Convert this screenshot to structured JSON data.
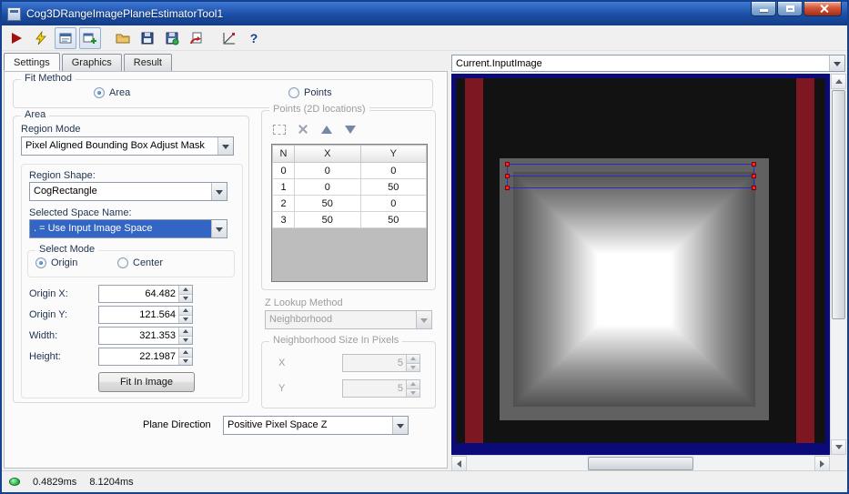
{
  "colors": {
    "titlebar_blue": "#1c4ea6",
    "selection_highlight": "#3365c4",
    "image_frame_navy": "#0a0a78",
    "image_stripe_red": "#7d1722",
    "selection_rect_blue": "#2a2ad0",
    "handle_red": "#ff2020",
    "led_green": "#2fbe4e"
  },
  "window": {
    "title": "Cog3DRangeImagePlaneEstimatorTool1"
  },
  "toolbar": {
    "icons": [
      "run-icon",
      "live-run-icon",
      "tool-editor-icon",
      "new-tool-icon",
      "open-file-icon",
      "save-icon",
      "save-image-icon",
      "revert-icon",
      "benchmark-icon",
      "help-icon"
    ],
    "help_glyph": "?"
  },
  "tabs": {
    "items": [
      {
        "label": "Settings",
        "active": true
      },
      {
        "label": "Graphics",
        "active": false
      },
      {
        "label": "Result",
        "active": false
      }
    ]
  },
  "settings": {
    "fit_method": {
      "label": "Fit Method",
      "options": [
        {
          "label": "Area",
          "selected": true
        },
        {
          "label": "Points",
          "selected": false
        }
      ]
    },
    "area": {
      "label": "Area",
      "region_mode_label": "Region Mode",
      "region_mode_value": "Pixel Aligned Bounding Box Adjust Mask",
      "region_shape_label": "Region Shape:",
      "region_shape_value": "CogRectangle",
      "selected_space_label": "Selected Space Name:",
      "selected_space_value": ". = Use Input Image Space",
      "select_mode": {
        "label": "Select Mode",
        "options": [
          {
            "label": "Origin",
            "selected": true
          },
          {
            "label": "Center",
            "selected": false
          }
        ]
      },
      "fields": [
        {
          "label": "Origin X:",
          "value": "64.482"
        },
        {
          "label": "Origin Y:",
          "value": "121.564"
        },
        {
          "label": "Width:",
          "value": "321.353"
        },
        {
          "label": "Height:",
          "value": "22.1987"
        }
      ],
      "fit_button_label": "Fit In Image"
    },
    "points": {
      "label": "Points (2D locations)",
      "table": {
        "headers": [
          "N",
          "X",
          "Y"
        ],
        "rows": [
          [
            "0",
            "0",
            "0"
          ],
          [
            "1",
            "0",
            "50"
          ],
          [
            "2",
            "50",
            "0"
          ],
          [
            "3",
            "50",
            "50"
          ]
        ]
      }
    },
    "z_lookup": {
      "label": "Z Lookup Method",
      "value": "Neighborhood"
    },
    "neighborhood": {
      "label": "Neighborhood Size In Pixels",
      "x_label": "X",
      "x_value": "5",
      "y_label": "Y",
      "y_value": "5"
    },
    "plane_direction": {
      "label": "Plane Direction",
      "value": "Positive Pixel Space Z"
    }
  },
  "image_panel": {
    "source": "Current.InputImage"
  },
  "status": {
    "time1": "0.4829ms",
    "time2": "8.1204ms"
  }
}
